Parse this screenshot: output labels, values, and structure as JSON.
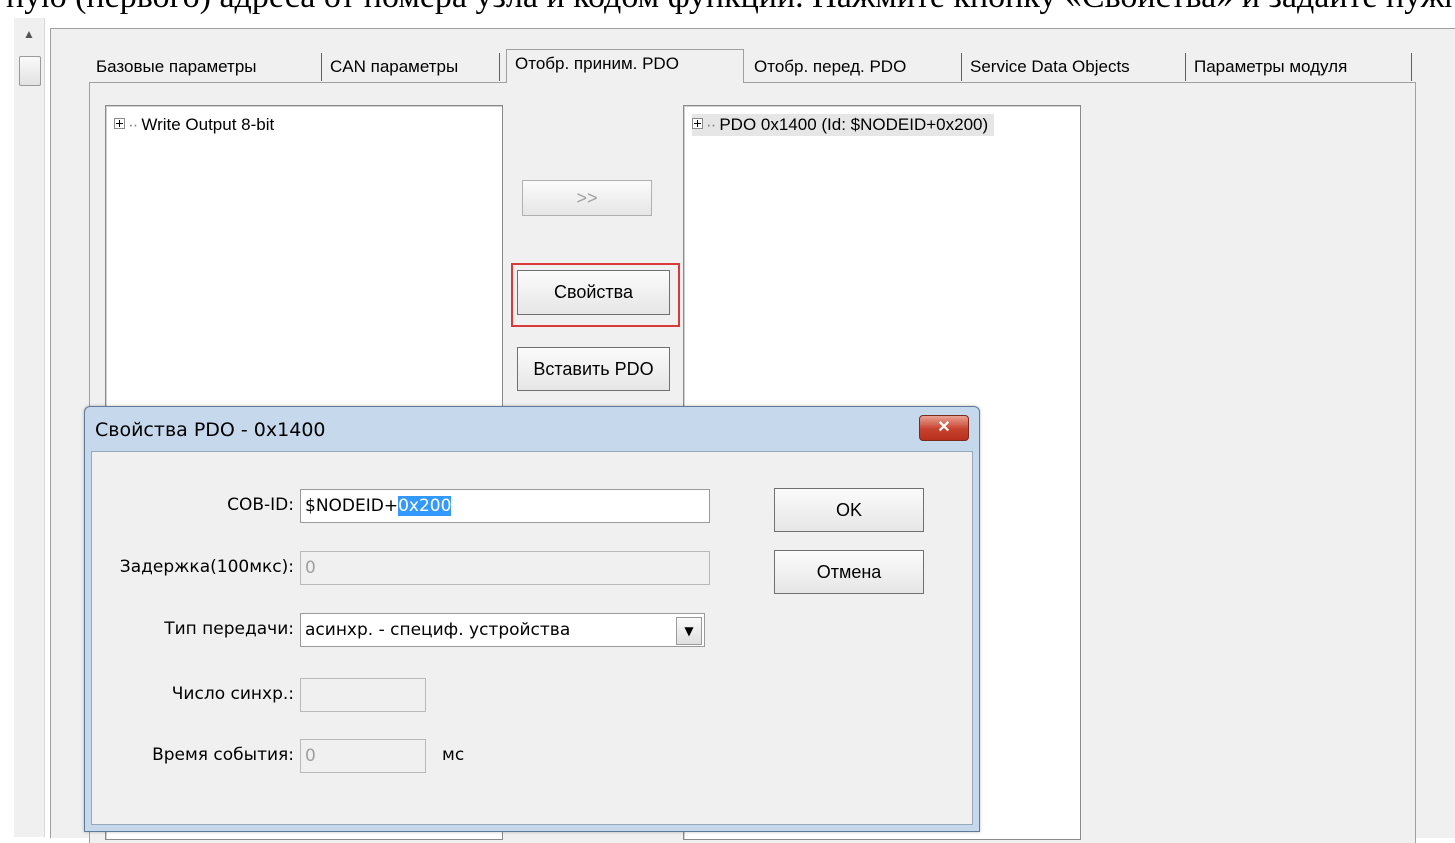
{
  "top_text": "ную (первого) адреса от номера узла и кодом функции. Нажмите кнопку «Свойства» и задайте нужный адрес",
  "scrollbar": {
    "up_arrow": "▲"
  },
  "tabs": [
    {
      "label": "Базовые параметры"
    },
    {
      "label": "CAN параметры"
    },
    {
      "label": "Отобр. приним. PDO"
    },
    {
      "label": "Отобр. перед. PDO"
    },
    {
      "label": "Service Data Objects"
    },
    {
      "label": "Параметры модуля"
    }
  ],
  "left_list": {
    "items": [
      {
        "label": "Write Output 8-bit"
      }
    ]
  },
  "right_list": {
    "items": [
      {
        "label": "PDO 0x1400 (Id: $NODEID+0x200)"
      }
    ]
  },
  "buttons": {
    "move": ">>",
    "properties": "Свойства",
    "insert_pdo": "Вставить PDO"
  },
  "dialog": {
    "title": "Свойства PDO - 0x1400",
    "close": "✕",
    "cob_id": {
      "label": "COB-ID:",
      "value_prefix": "$NODEID+",
      "value_selected": "0x200"
    },
    "delay": {
      "label": "Задержка(100мкс):",
      "value": "0"
    },
    "transmission_type": {
      "label": "Тип передачи:",
      "value": "асинхр. - специф. устройства"
    },
    "sync_number": {
      "label": "Число синхр.:",
      "value": ""
    },
    "event_time": {
      "label": "Время события:",
      "value": "0",
      "unit": "мс"
    },
    "ok": "OK",
    "cancel": "Отмена"
  },
  "colors": {
    "highlight": "#d93a3a",
    "selection": "#3399ff",
    "close_button": "#c7412d"
  }
}
